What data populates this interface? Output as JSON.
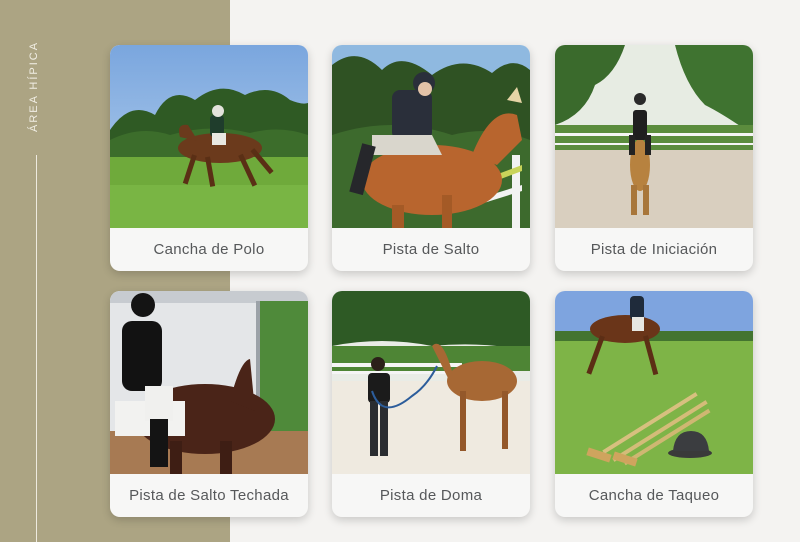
{
  "sidebar": {
    "label": "ÁREA HÍPICA"
  },
  "colors": {
    "sidebar_bg": "#aca483",
    "page_bg": "#f4f3f1",
    "card_bg": "#f7f7f6",
    "caption_text": "#56585a"
  },
  "cards": [
    {
      "label": "Cancha de Polo",
      "image": "polo-field-photo"
    },
    {
      "label": "Pista de Salto",
      "image": "show-jumping-photo"
    },
    {
      "label": "Pista de Iniciación",
      "image": "beginner-arena-photo"
    },
    {
      "label": "Pista de Salto Techada",
      "image": "indoor-jumping-photo"
    },
    {
      "label": "Pista de Doma",
      "image": "horse-training-photo"
    },
    {
      "label": "Cancha de Taqueo",
      "image": "polo-practice-photo"
    }
  ]
}
